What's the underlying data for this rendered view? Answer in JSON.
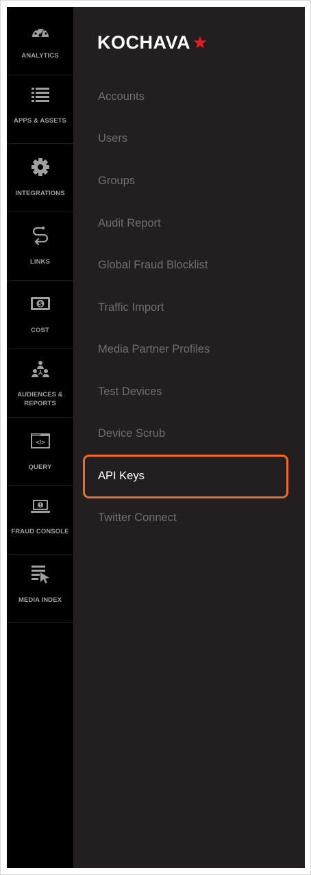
{
  "brand": {
    "name": "KOCHAVA",
    "star_color": "#e31b23"
  },
  "rail": {
    "items": [
      {
        "label": "ANALYTICS",
        "icon": "dashboard-gauge-icon"
      },
      {
        "label": "APPS & ASSETS",
        "icon": "list-icon"
      },
      {
        "label": "INTEGRATIONS",
        "icon": "gear-icon"
      },
      {
        "label": "LINKS",
        "icon": "route-icon"
      },
      {
        "label": "COST",
        "icon": "dollar-bill-icon"
      },
      {
        "label": "AUDIENCES & REPORTS",
        "icon": "people-icon"
      },
      {
        "label": "QUERY",
        "icon": "code-window-icon"
      },
      {
        "label": "FRAUD CONSOLE",
        "icon": "laptop-alert-icon"
      },
      {
        "label": "MEDIA INDEX",
        "icon": "list-cursor-icon"
      }
    ]
  },
  "menu": {
    "items": [
      {
        "label": "Accounts"
      },
      {
        "label": "Users"
      },
      {
        "label": "Groups"
      },
      {
        "label": "Audit Report"
      },
      {
        "label": "Global Fraud Blocklist"
      },
      {
        "label": "Traffic Import"
      },
      {
        "label": "Media Partner Profiles"
      },
      {
        "label": "Test Devices"
      },
      {
        "label": "Device Scrub"
      },
      {
        "label": "API Keys"
      },
      {
        "label": "Twitter Connect"
      }
    ],
    "active_index": 9,
    "highlight_color": "#ef6c26"
  }
}
